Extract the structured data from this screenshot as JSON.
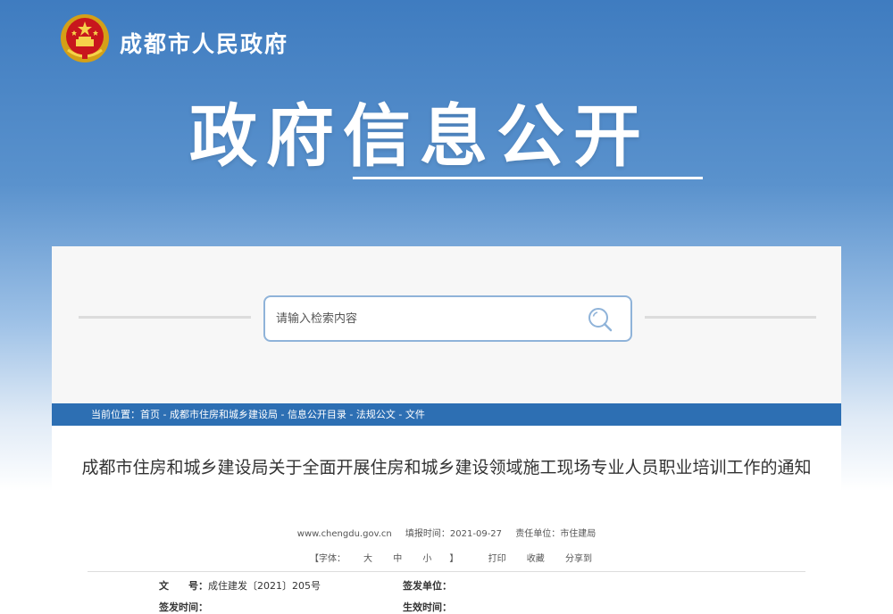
{
  "header": {
    "site_name": "成都市人民政府",
    "banner_title": "政府信息公开"
  },
  "search": {
    "placeholder": "请输入检索内容"
  },
  "breadcrumb": {
    "label": "当前位置：",
    "items": [
      "首页",
      "成都市住房和城乡建设局",
      "信息公开目录",
      "法规公文",
      "文件"
    ],
    "separator": " - "
  },
  "article": {
    "title": "成都市住房和城乡建设局关于全面开展住房和城乡建设领域施工现场专业人员职业培训工作的通知",
    "meta": {
      "site": "www.chengdu.gov.cn",
      "fill_time": "填报时间：2021-09-27",
      "unit": "责任单位：市住建局"
    },
    "tools": {
      "font_prefix": "【字体：",
      "font_large": "大",
      "font_medium": "中",
      "font_small": "小",
      "font_suffix": "】",
      "print": "打印",
      "favorite": "收藏",
      "share": "分享到"
    },
    "info": {
      "doc_no_label": "文　　号：",
      "doc_no_value": "成住建发〔2021〕205号",
      "issuer_label": "签发单位：",
      "issuer_value": "",
      "issue_time_label": "签发时间：",
      "issue_time_value": "",
      "effective_time_label": "生效时间：",
      "effective_time_value": ""
    }
  },
  "colors": {
    "header_blue": "#3f7cc0",
    "breadcrumb_bar": "#2d6fb3",
    "search_border": "#8fb3d9"
  },
  "icons": {
    "emblem": "national-emblem-icon",
    "search": "search-icon"
  }
}
